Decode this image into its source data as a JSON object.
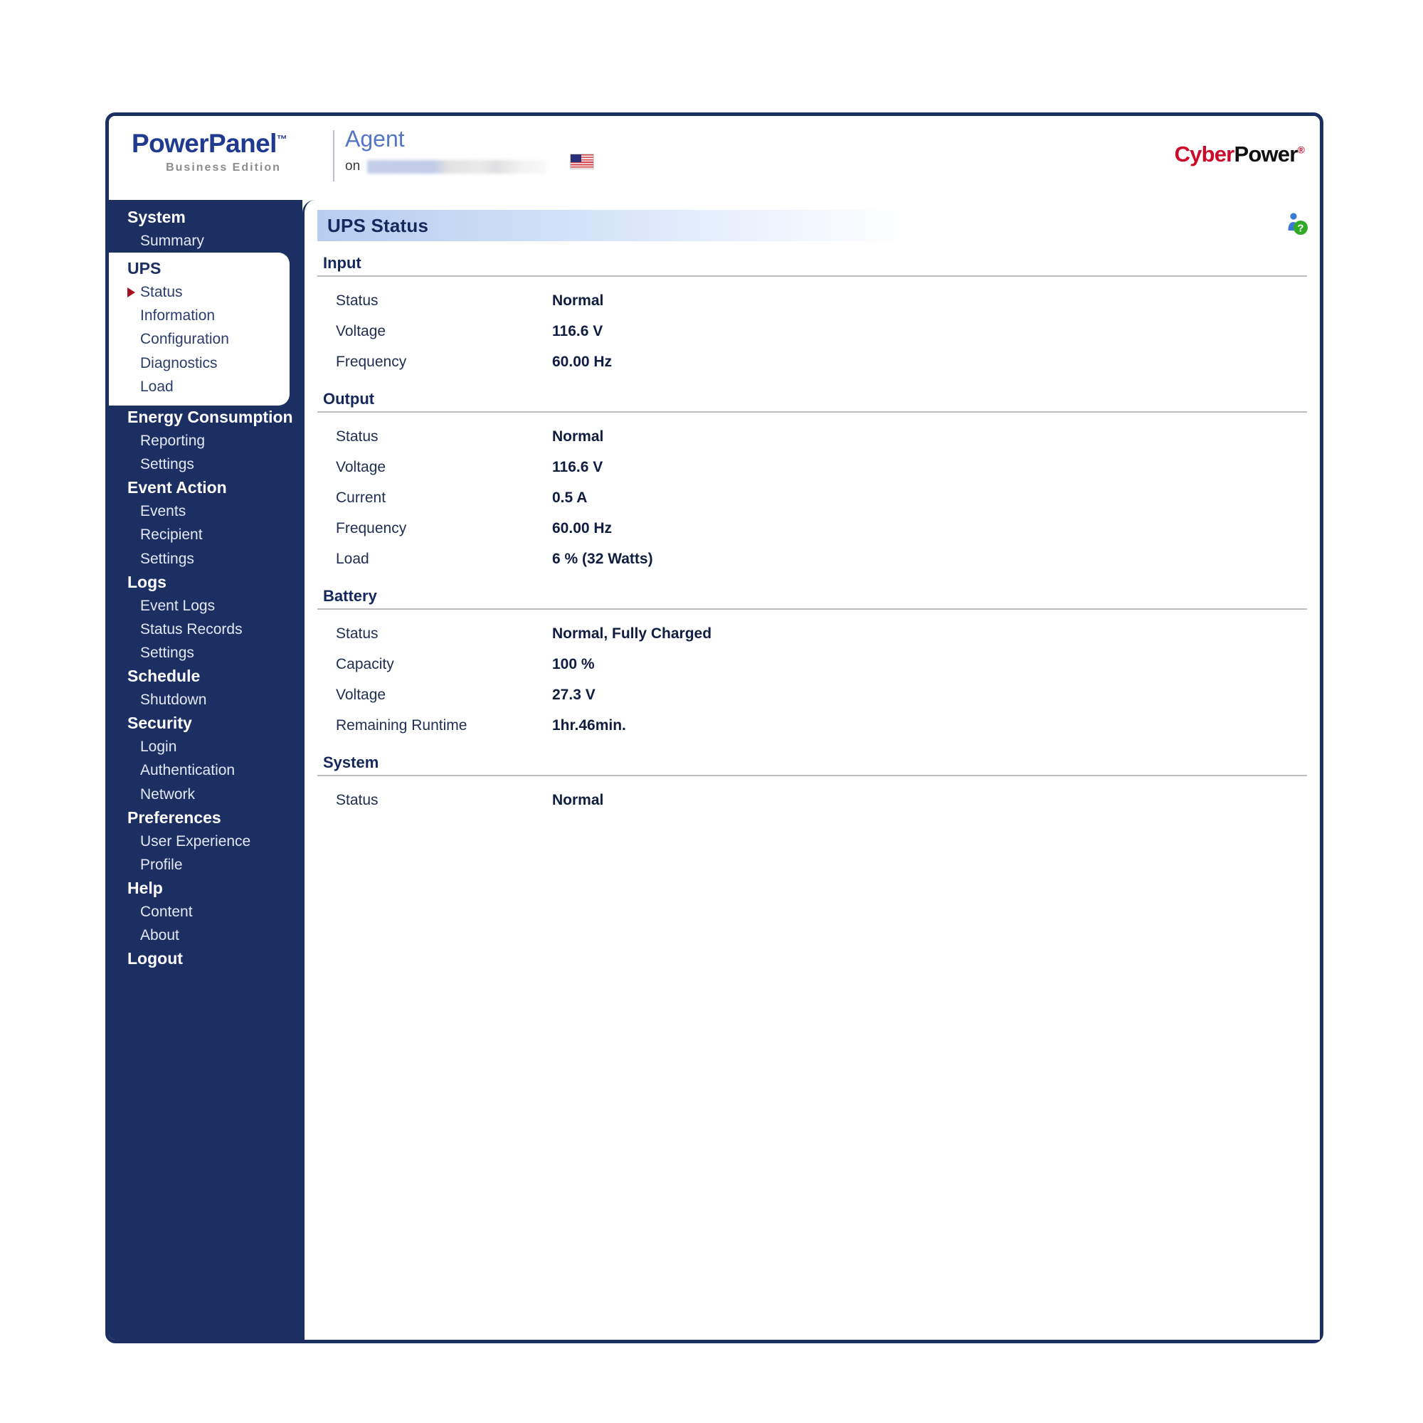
{
  "header": {
    "logo_main": "PowerPanel",
    "logo_tm": "™",
    "logo_sub": "Business Edition",
    "agent_title": "Agent",
    "agent_on_label": "on",
    "agent_host": "",
    "flag_icon": "us-flag-icon",
    "brand_cyber": "Cyber",
    "brand_power": "Power",
    "brand_reg": "®"
  },
  "sidebar": {
    "groups": [
      {
        "header": "System",
        "active": false,
        "items": [
          {
            "label": "Summary",
            "selected": false
          }
        ]
      },
      {
        "header": "UPS",
        "active": true,
        "items": [
          {
            "label": "Status",
            "selected": true
          },
          {
            "label": "Information",
            "selected": false
          },
          {
            "label": "Configuration",
            "selected": false
          },
          {
            "label": "Diagnostics",
            "selected": false
          },
          {
            "label": "Load",
            "selected": false
          }
        ]
      },
      {
        "header": "Energy Consumption",
        "active": false,
        "items": [
          {
            "label": "Reporting",
            "selected": false
          },
          {
            "label": "Settings",
            "selected": false
          }
        ]
      },
      {
        "header": "Event Action",
        "active": false,
        "items": [
          {
            "label": "Events",
            "selected": false
          },
          {
            "label": "Recipient",
            "selected": false
          },
          {
            "label": "Settings",
            "selected": false
          }
        ]
      },
      {
        "header": "Logs",
        "active": false,
        "items": [
          {
            "label": "Event Logs",
            "selected": false
          },
          {
            "label": "Status Records",
            "selected": false
          },
          {
            "label": "Settings",
            "selected": false
          }
        ]
      },
      {
        "header": "Schedule",
        "active": false,
        "items": [
          {
            "label": "Shutdown",
            "selected": false
          }
        ]
      },
      {
        "header": "Security",
        "active": false,
        "items": [
          {
            "label": "Login",
            "selected": false
          },
          {
            "label": "Authentication",
            "selected": false
          },
          {
            "label": "Network",
            "selected": false
          }
        ]
      },
      {
        "header": "Preferences",
        "active": false,
        "items": [
          {
            "label": "User Experience",
            "selected": false
          },
          {
            "label": "Profile",
            "selected": false
          }
        ]
      },
      {
        "header": "Help",
        "active": false,
        "items": [
          {
            "label": "Content",
            "selected": false
          },
          {
            "label": "About",
            "selected": false
          }
        ]
      },
      {
        "header": "Logout",
        "active": false,
        "items": []
      }
    ]
  },
  "main": {
    "panel_title": "UPS Status",
    "help_icon": "help-person-icon",
    "sections": [
      {
        "title": "Input",
        "rows": [
          {
            "label": "Status",
            "value": "Normal"
          },
          {
            "label": "Voltage",
            "value": "116.6 V"
          },
          {
            "label": "Frequency",
            "value": "60.00 Hz"
          }
        ]
      },
      {
        "title": "Output",
        "rows": [
          {
            "label": "Status",
            "value": "Normal"
          },
          {
            "label": "Voltage",
            "value": "116.6 V"
          },
          {
            "label": "Current",
            "value": "0.5 A"
          },
          {
            "label": "Frequency",
            "value": "60.00 Hz"
          },
          {
            "label": "Load",
            "value": "6 % (32 Watts)"
          }
        ]
      },
      {
        "title": "Battery",
        "rows": [
          {
            "label": "Status",
            "value": "Normal, Fully Charged"
          },
          {
            "label": "Capacity",
            "value": "100 %"
          },
          {
            "label": "Voltage",
            "value": "27.3 V"
          },
          {
            "label": "Remaining Runtime",
            "value": "1hr.46min."
          }
        ]
      },
      {
        "title": "System",
        "rows": [
          {
            "label": "Status",
            "value": "Normal"
          }
        ]
      }
    ]
  },
  "colors": {
    "navy": "#1b2f63",
    "brand_red": "#cc0b2a",
    "accent_blue": "#5576c4",
    "marker_red": "#a31220",
    "title_gradient_start": "#b7cdf0"
  }
}
